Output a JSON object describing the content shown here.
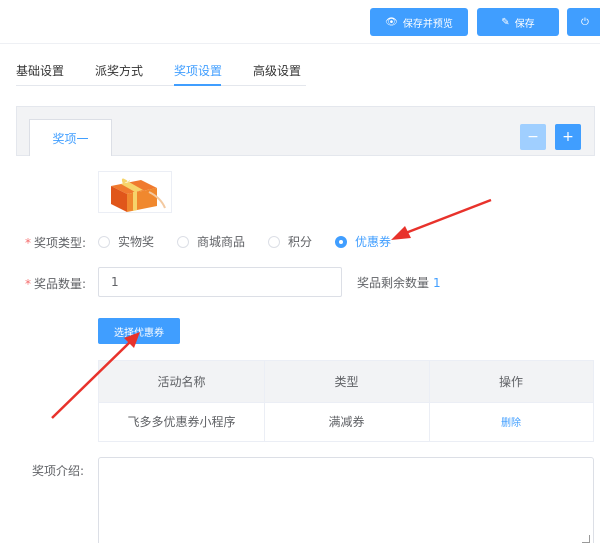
{
  "toolbar": {
    "save_preview_label": "保存并预览",
    "save_label": "保存",
    "power_icon": "power-icon",
    "eye_icon": "eye-icon",
    "edit_icon": "edit-icon"
  },
  "tabs": [
    {
      "label": "基础设置",
      "active": false
    },
    {
      "label": "派奖方式",
      "active": false
    },
    {
      "label": "奖项设置",
      "active": true
    },
    {
      "label": "高级设置",
      "active": false
    }
  ],
  "prize_panel": {
    "tab_label": "奖项一",
    "remove_label": "−",
    "add_label": "+"
  },
  "prize_type": {
    "label": "奖项类型:",
    "options": [
      "实物奖",
      "商城商品",
      "积分",
      "优惠券"
    ],
    "selected": "优惠券"
  },
  "prize_quantity": {
    "label": "奖品数量:",
    "value": "1",
    "remaining_label": "奖品剩余数量",
    "remaining_value": "1"
  },
  "select_coupon_label": "选择优惠券",
  "coupon_table": {
    "headers": [
      "活动名称",
      "类型",
      "操作"
    ],
    "rows": [
      {
        "name": "飞多多优惠券小程序",
        "type": "满减券",
        "action": "删除"
      }
    ]
  },
  "description": {
    "label": "奖项介绍:",
    "value": ""
  },
  "colors": {
    "primary": "#409eff",
    "disabled": "#a0cfff",
    "required": "#f56c6c",
    "arrow": "#e8322b"
  }
}
